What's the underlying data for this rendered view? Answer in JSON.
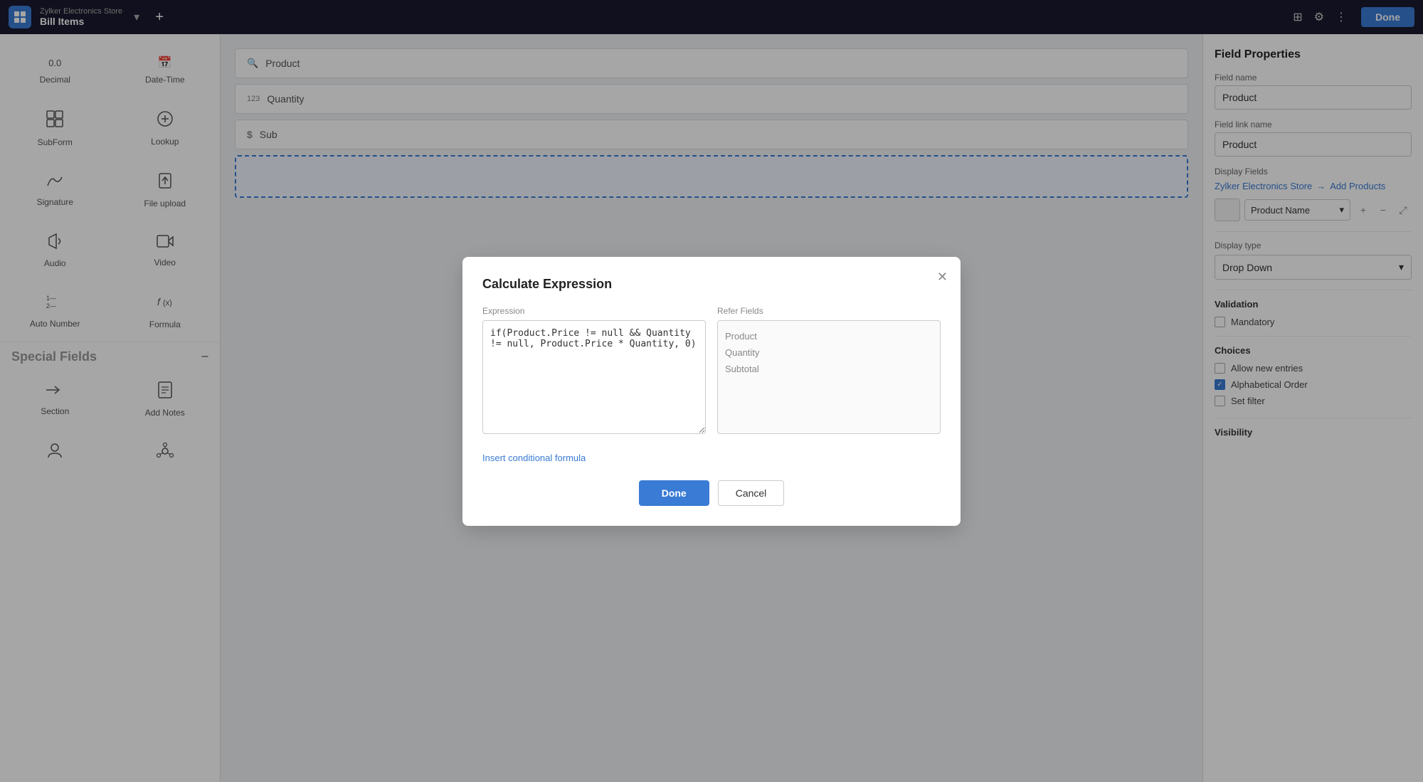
{
  "topbar": {
    "company": "Zylker Electronics Store",
    "page": "Bill Items",
    "done_label": "Done"
  },
  "sidebar": {
    "items_top": [
      {
        "id": "decimal",
        "icon": "decimal",
        "label": "Decimal"
      },
      {
        "id": "datetime",
        "icon": "datetime",
        "label": "Date-Time"
      },
      {
        "id": "subform",
        "icon": "subform",
        "label": "SubForm"
      },
      {
        "id": "lookup",
        "icon": "lookup",
        "label": "Lookup"
      },
      {
        "id": "signature",
        "icon": "signature",
        "label": "Signature"
      },
      {
        "id": "fileupload",
        "icon": "fileupload",
        "label": "File upload"
      },
      {
        "id": "audio",
        "icon": "audio",
        "label": "Audio"
      },
      {
        "id": "video",
        "icon": "video",
        "label": "Video"
      },
      {
        "id": "autonumber",
        "icon": "autonumber",
        "label": "Auto Number"
      },
      {
        "id": "formula",
        "icon": "formula",
        "label": "Formula"
      }
    ],
    "special_fields_label": "Special Fields",
    "items_special": [
      {
        "id": "section",
        "icon": "section",
        "label": "Section"
      },
      {
        "id": "addnotes",
        "icon": "addnotes",
        "label": "Add Notes"
      },
      {
        "id": "person",
        "icon": "person",
        "label": ""
      },
      {
        "id": "network",
        "icon": "network",
        "label": ""
      }
    ]
  },
  "canvas": {
    "fields": [
      {
        "id": "product",
        "icon": "search",
        "label": "Product"
      },
      {
        "id": "quantity",
        "icon": "hash",
        "label": "Quantity"
      },
      {
        "id": "subtotal",
        "icon": "dollar",
        "label": "Sub"
      }
    ],
    "drop_zone": ""
  },
  "modal": {
    "title": "Calculate Expression",
    "expression_label": "Expression",
    "refer_label": "Refer Fields",
    "expression_value": "if(Product.Price != null && Quantity != null, Product.Price * Quantity, 0)",
    "refer_fields": [
      "Product",
      "Quantity",
      "Subtotal"
    ],
    "insert_formula_link": "Insert conditional formula",
    "done_label": "Done",
    "cancel_label": "Cancel"
  },
  "right_panel": {
    "title": "Field Properties",
    "field_name_label": "Field name",
    "field_name_value": "Product",
    "field_link_name_label": "Field link name",
    "field_link_name_value": "Product",
    "display_fields_label": "Display Fields",
    "company_link": "Zylker Electronics Store",
    "arrow": "→",
    "add_products_link": "Add Products",
    "display_field_select": "Product Name",
    "display_type_label": "Display type",
    "display_type_value": "Drop Down",
    "validation_label": "Validation",
    "mandatory_label": "Mandatory",
    "choices_label": "Choices",
    "choices": [
      {
        "label": "Allow new entries",
        "checked": false
      },
      {
        "label": "Alphabetical Order",
        "checked": true
      },
      {
        "label": "Set filter",
        "checked": false
      }
    ],
    "visibility_label": "Visibility"
  }
}
